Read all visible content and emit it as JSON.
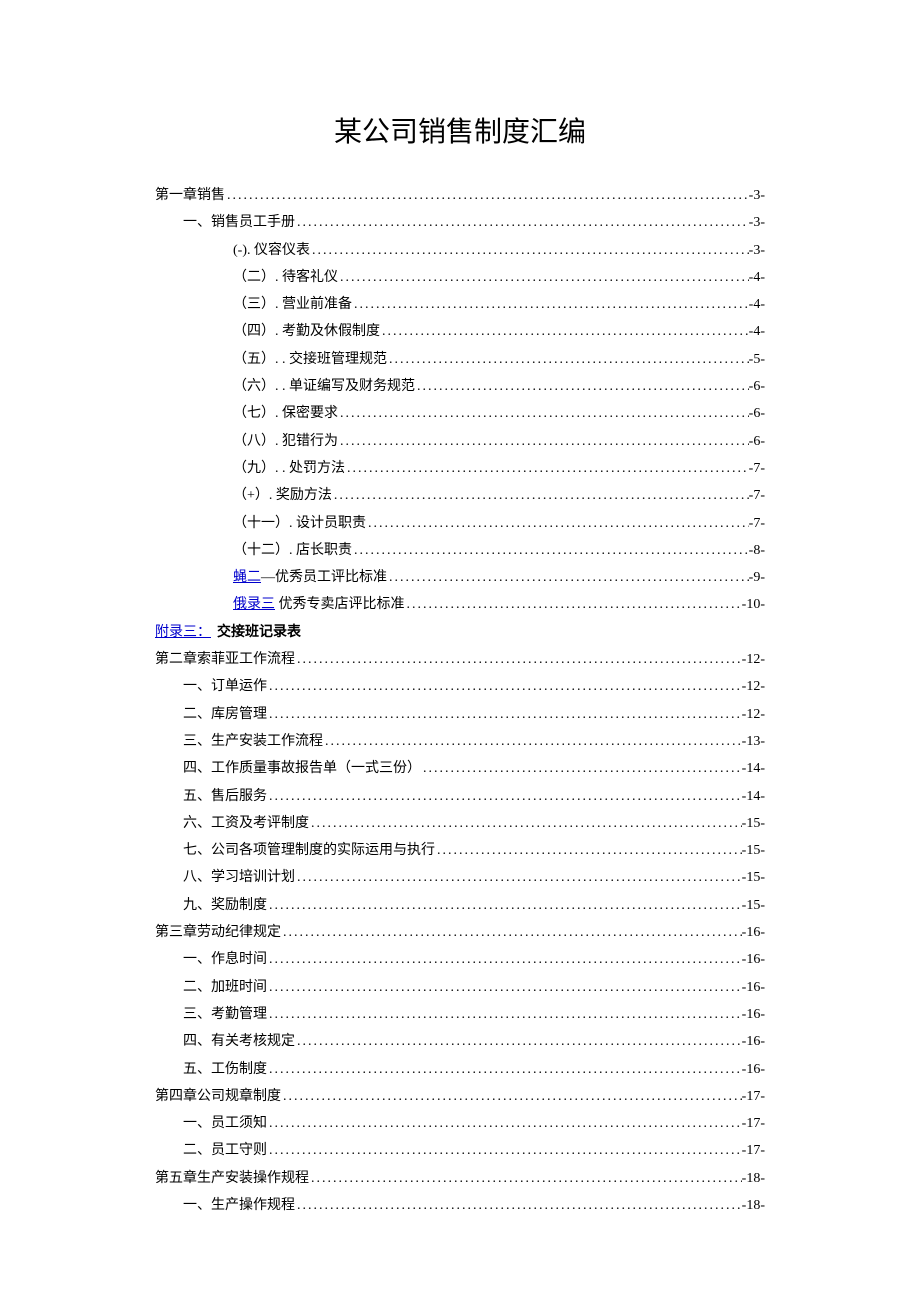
{
  "title": "某公司销售制度汇编",
  "toc": [
    {
      "indent": 0,
      "label": "第一章销售",
      "page": "-3-"
    },
    {
      "indent": 1,
      "label": "一、销售员工手册",
      "page": "-3-"
    },
    {
      "indent": 2,
      "label": "(-). 仪容仪表",
      "page": "-3-"
    },
    {
      "indent": 2,
      "label": "（二）. 待客礼仪",
      "page": "-4-"
    },
    {
      "indent": 2,
      "label": "（三）. 营业前准备",
      "page": "-4-"
    },
    {
      "indent": 2,
      "label": "（四）. 考勤及休假制度",
      "page": "-4-"
    },
    {
      "indent": 2,
      "label": "（五）. . 交接班管理规范",
      "page": "-5-"
    },
    {
      "indent": 2,
      "label": "（六）. . 单证编写及财务规范",
      "page": "-6-"
    },
    {
      "indent": 2,
      "label": "（七）. 保密要求",
      "page": "-6-"
    },
    {
      "indent": 2,
      "label": "（八）. 犯错行为",
      "page": "-6-"
    },
    {
      "indent": 2,
      "label": "（九）. . 处罚方法",
      "page": "-7-"
    },
    {
      "indent": 2,
      "label": "（+）. 奖励方法",
      "page": "-7-"
    },
    {
      "indent": 2,
      "label": "（十一）. 设计员职责",
      "page": "-7-"
    },
    {
      "indent": 2,
      "label": "（十二）. 店长职责",
      "page": "-8-"
    },
    {
      "indent": 2,
      "prefix": "蝇二",
      "prefixLink": true,
      "label": "—优秀员工评比标准",
      "page": "-9-"
    },
    {
      "indent": 2,
      "prefix": "俄录三",
      "prefixLink": true,
      "label": " 优秀专卖店评比标准",
      "page": "-10-"
    }
  ],
  "appendix3": {
    "label": "附录三：",
    "text": "交接班记录表"
  },
  "toc2": [
    {
      "indent": 0,
      "label": "第二章索菲亚工作流程",
      "page": "-12-"
    },
    {
      "indent": 1,
      "label": "一、订单运作",
      "page": "-12-"
    },
    {
      "indent": 1,
      "label": "二、库房管理",
      "page": "-12-"
    },
    {
      "indent": 1,
      "label": "三、生产安装工作流程",
      "page": "-13-"
    },
    {
      "indent": 1,
      "label": "四、工作质量事故报告单（一式三份）",
      "page": "-14-"
    },
    {
      "indent": 1,
      "label": "五、售后服务",
      "page": "-14-"
    },
    {
      "indent": 1,
      "label": "六、工资及考评制度",
      "page": "-15-"
    },
    {
      "indent": 1,
      "label": "七、公司各项管理制度的实际运用与执行",
      "page": "-15-"
    },
    {
      "indent": 1,
      "label": "八、学习培训计划",
      "page": "-15-"
    },
    {
      "indent": 1,
      "label": "九、奖励制度",
      "page": "-15-"
    },
    {
      "indent": 0,
      "label": "第三章劳动纪律规定",
      "page": "-16-"
    },
    {
      "indent": 1,
      "label": "一、作息时间",
      "page": "-16-"
    },
    {
      "indent": 1,
      "label": "二、加班时间",
      "page": "-16-"
    },
    {
      "indent": 1,
      "label": "三、考勤管理",
      "page": "-16-"
    },
    {
      "indent": 1,
      "label": "四、有关考核规定",
      "page": "-16-"
    },
    {
      "indent": 1,
      "label": "五、工伤制度",
      "page": "-16-"
    },
    {
      "indent": 0,
      "label": "第四章公司规章制度",
      "page": "-17-"
    },
    {
      "indent": 1,
      "label": "一、员工须知",
      "page": "-17-"
    },
    {
      "indent": 1,
      "label": "二、员工守则",
      "page": "-17-"
    },
    {
      "indent": 0,
      "label": "第五章生产安装操作规程",
      "page": "-18-"
    },
    {
      "indent": 1,
      "label": "一、生产操作规程",
      "page": "-18-"
    }
  ]
}
